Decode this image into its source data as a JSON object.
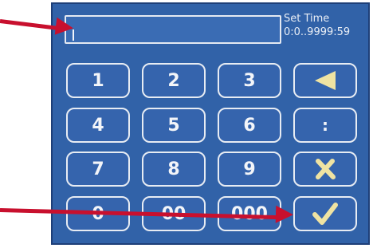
{
  "header": {
    "title": "Set Time",
    "range": "0:0..9999:59"
  },
  "input": {
    "value": ""
  },
  "keypad": {
    "keys": [
      "1",
      "2",
      "3",
      "4",
      "5",
      "6",
      "7",
      "8",
      "9",
      "0",
      "00",
      "000"
    ]
  },
  "actions": {
    "backspace_icon": "left-triangle-icon",
    "colon_label": ":",
    "cancel_icon": "x-icon",
    "confirm_icon": "checkmark-icon"
  },
  "colors": {
    "panel": "#3162a8",
    "key_border": "#e7ecf3",
    "action_accent": "#efe3a2",
    "annotation_arrow": "#c8102e"
  }
}
